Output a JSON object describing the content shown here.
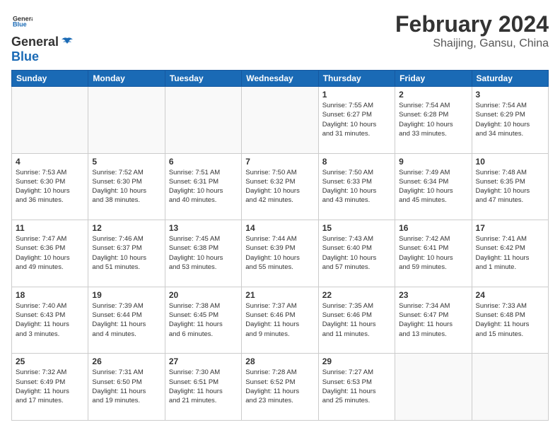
{
  "logo": {
    "line1": "General",
    "line2": "Blue"
  },
  "title": "February 2024",
  "location": "Shaijing, Gansu, China",
  "weekdays": [
    "Sunday",
    "Monday",
    "Tuesday",
    "Wednesday",
    "Thursday",
    "Friday",
    "Saturday"
  ],
  "weeks": [
    [
      {
        "day": "",
        "info": ""
      },
      {
        "day": "",
        "info": ""
      },
      {
        "day": "",
        "info": ""
      },
      {
        "day": "",
        "info": ""
      },
      {
        "day": "1",
        "info": "Sunrise: 7:55 AM\nSunset: 6:27 PM\nDaylight: 10 hours\nand 31 minutes."
      },
      {
        "day": "2",
        "info": "Sunrise: 7:54 AM\nSunset: 6:28 PM\nDaylight: 10 hours\nand 33 minutes."
      },
      {
        "day": "3",
        "info": "Sunrise: 7:54 AM\nSunset: 6:29 PM\nDaylight: 10 hours\nand 34 minutes."
      }
    ],
    [
      {
        "day": "4",
        "info": "Sunrise: 7:53 AM\nSunset: 6:30 PM\nDaylight: 10 hours\nand 36 minutes."
      },
      {
        "day": "5",
        "info": "Sunrise: 7:52 AM\nSunset: 6:30 PM\nDaylight: 10 hours\nand 38 minutes."
      },
      {
        "day": "6",
        "info": "Sunrise: 7:51 AM\nSunset: 6:31 PM\nDaylight: 10 hours\nand 40 minutes."
      },
      {
        "day": "7",
        "info": "Sunrise: 7:50 AM\nSunset: 6:32 PM\nDaylight: 10 hours\nand 42 minutes."
      },
      {
        "day": "8",
        "info": "Sunrise: 7:50 AM\nSunset: 6:33 PM\nDaylight: 10 hours\nand 43 minutes."
      },
      {
        "day": "9",
        "info": "Sunrise: 7:49 AM\nSunset: 6:34 PM\nDaylight: 10 hours\nand 45 minutes."
      },
      {
        "day": "10",
        "info": "Sunrise: 7:48 AM\nSunset: 6:35 PM\nDaylight: 10 hours\nand 47 minutes."
      }
    ],
    [
      {
        "day": "11",
        "info": "Sunrise: 7:47 AM\nSunset: 6:36 PM\nDaylight: 10 hours\nand 49 minutes."
      },
      {
        "day": "12",
        "info": "Sunrise: 7:46 AM\nSunset: 6:37 PM\nDaylight: 10 hours\nand 51 minutes."
      },
      {
        "day": "13",
        "info": "Sunrise: 7:45 AM\nSunset: 6:38 PM\nDaylight: 10 hours\nand 53 minutes."
      },
      {
        "day": "14",
        "info": "Sunrise: 7:44 AM\nSunset: 6:39 PM\nDaylight: 10 hours\nand 55 minutes."
      },
      {
        "day": "15",
        "info": "Sunrise: 7:43 AM\nSunset: 6:40 PM\nDaylight: 10 hours\nand 57 minutes."
      },
      {
        "day": "16",
        "info": "Sunrise: 7:42 AM\nSunset: 6:41 PM\nDaylight: 10 hours\nand 59 minutes."
      },
      {
        "day": "17",
        "info": "Sunrise: 7:41 AM\nSunset: 6:42 PM\nDaylight: 11 hours\nand 1 minute."
      }
    ],
    [
      {
        "day": "18",
        "info": "Sunrise: 7:40 AM\nSunset: 6:43 PM\nDaylight: 11 hours\nand 3 minutes."
      },
      {
        "day": "19",
        "info": "Sunrise: 7:39 AM\nSunset: 6:44 PM\nDaylight: 11 hours\nand 4 minutes."
      },
      {
        "day": "20",
        "info": "Sunrise: 7:38 AM\nSunset: 6:45 PM\nDaylight: 11 hours\nand 6 minutes."
      },
      {
        "day": "21",
        "info": "Sunrise: 7:37 AM\nSunset: 6:46 PM\nDaylight: 11 hours\nand 9 minutes."
      },
      {
        "day": "22",
        "info": "Sunrise: 7:35 AM\nSunset: 6:46 PM\nDaylight: 11 hours\nand 11 minutes."
      },
      {
        "day": "23",
        "info": "Sunrise: 7:34 AM\nSunset: 6:47 PM\nDaylight: 11 hours\nand 13 minutes."
      },
      {
        "day": "24",
        "info": "Sunrise: 7:33 AM\nSunset: 6:48 PM\nDaylight: 11 hours\nand 15 minutes."
      }
    ],
    [
      {
        "day": "25",
        "info": "Sunrise: 7:32 AM\nSunset: 6:49 PM\nDaylight: 11 hours\nand 17 minutes."
      },
      {
        "day": "26",
        "info": "Sunrise: 7:31 AM\nSunset: 6:50 PM\nDaylight: 11 hours\nand 19 minutes."
      },
      {
        "day": "27",
        "info": "Sunrise: 7:30 AM\nSunset: 6:51 PM\nDaylight: 11 hours\nand 21 minutes."
      },
      {
        "day": "28",
        "info": "Sunrise: 7:28 AM\nSunset: 6:52 PM\nDaylight: 11 hours\nand 23 minutes."
      },
      {
        "day": "29",
        "info": "Sunrise: 7:27 AM\nSunset: 6:53 PM\nDaylight: 11 hours\nand 25 minutes."
      },
      {
        "day": "",
        "info": ""
      },
      {
        "day": "",
        "info": ""
      }
    ]
  ]
}
